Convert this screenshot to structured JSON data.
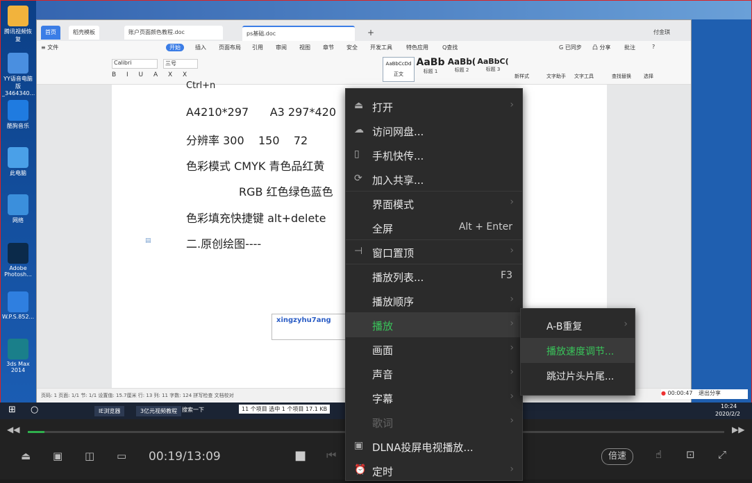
{
  "desktop": {
    "icons": [
      {
        "label": "腾讯视频恢复",
        "icon": "folder-icon",
        "color": "#f2b33c"
      },
      {
        "label": "YY语音电脑版_3464340...",
        "icon": "yy-icon",
        "color": "#4a8fe0"
      },
      {
        "label": "酷狗音乐",
        "icon": "kugou-icon",
        "color": "#1f7be0"
      },
      {
        "label": "此电脑",
        "icon": "computer-icon",
        "color": "#4aa0e8"
      },
      {
        "label": "网络",
        "icon": "network-icon",
        "color": "#3b8fdc"
      },
      {
        "label": "Adobe Photosh...",
        "icon": "photoshop-icon",
        "color": "#0b2a4a"
      },
      {
        "label": "W.P.S.852...",
        "icon": "wps-icon",
        "color": "#2f7fe0"
      },
      {
        "label": "3ds Max 2014",
        "icon": "3dsmax-icon",
        "color": "#1a7f8a"
      }
    ]
  },
  "wps": {
    "tabs": [
      "首页",
      "稻壳模板",
      "账户页面颜色教程.doc",
      "ps基础.doc"
    ],
    "right_user": "付金琪",
    "menu": [
      "≡ 文件",
      "开始",
      "插入",
      "页面布局",
      "引用",
      "审阅",
      "视图",
      "章节",
      "安全",
      "开发工具",
      "特色应用",
      "Q查找"
    ],
    "menu_right": [
      "G 已同步",
      "凸 分享",
      "批注",
      "?"
    ],
    "ribbon": {
      "font": "Calibri",
      "size": "三号",
      "styles": [
        "正文",
        "标题 1",
        "标题 2",
        "标题 3"
      ],
      "style_previews": [
        "AaBbCcDd",
        "AaBb",
        "AaBb(",
        "AaBbC("
      ],
      "tools": [
        "新样式",
        "文字助手",
        "文字工具",
        "查找替换",
        "选择"
      ]
    },
    "doc_lines": [
      "Ctrl+n",
      "A4210*297      A3 297*420",
      "分辨率 300    150    72",
      "色彩模式 CMYK 青色品红黄",
      "RGB 红色绿色蓝色",
      "色彩填充快捷键 alt+delete",
      "二.原创绘图----"
    ],
    "input_text": "xingzyhu7ang",
    "status": "页码: 1    页面: 1/1    节: 1/1    设置值: 15.7厘米    行: 13    列: 11    字数: 124    拼写检查    文档校对"
  },
  "taskbar": {
    "items": [
      "IE浏览器",
      "3亿元视频教程",
      "搜索一下"
    ],
    "time": "10:24",
    "date": "2020/2/2",
    "notify": "11 个项目    选中 1 个项目  17.1 KB"
  },
  "player": {
    "time_current": "00:19",
    "time_total": "13:09",
    "time_display": "00:19/13:09",
    "progress_fraction": 0.024,
    "speed_label": "倍速",
    "accent_color": "#2fb04d",
    "mini_time": "00:00:47",
    "share_label": "退出分享"
  },
  "context_menu": {
    "items": [
      {
        "label": "打开",
        "icon": "eject-icon",
        "submenu": true
      },
      {
        "label": "访问网盘...",
        "icon": "cloud-icon"
      },
      {
        "label": "手机快传...",
        "icon": "phone-icon"
      },
      {
        "label": "加入共享...",
        "icon": "share-icon"
      },
      {
        "label": "界面模式",
        "submenu": true
      },
      {
        "label": "全屏",
        "shortcut": "Alt + Enter"
      },
      {
        "label": "窗口置顶",
        "icon": "pin-icon",
        "submenu": true
      },
      {
        "label": "播放列表...",
        "shortcut": "F3"
      },
      {
        "label": "播放顺序",
        "submenu": true
      },
      {
        "label": "播放",
        "submenu": true,
        "highlighted": true
      },
      {
        "label": "画面",
        "submenu": true
      },
      {
        "label": "声音",
        "submenu": true
      },
      {
        "label": "字幕",
        "submenu": true
      },
      {
        "label": "歌词",
        "submenu": true,
        "disabled": true
      },
      {
        "label": "DLNA投屏电视播放...",
        "icon": "tv-icon"
      },
      {
        "label": "定时",
        "icon": "clock-icon",
        "submenu": true
      }
    ],
    "submenu": [
      {
        "label": "A-B重复",
        "submenu": true
      },
      {
        "label": "播放速度调节...",
        "highlighted": true
      },
      {
        "label": "跳过片头片尾..."
      }
    ]
  }
}
